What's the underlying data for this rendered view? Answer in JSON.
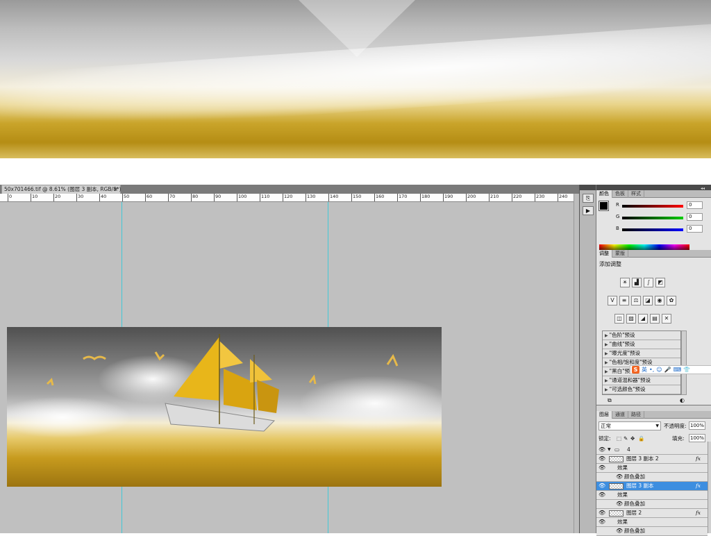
{
  "document": {
    "tab_title": "50x701466.tif @ 8.61% (图层 3 副本, RGB/8*)",
    "tab_close": "×",
    "ruler_ticks": [
      "0",
      "10",
      "20",
      "30",
      "40",
      "50",
      "60",
      "70",
      "80",
      "90",
      "100",
      "110",
      "120",
      "130",
      "140",
      "150",
      "160",
      "170",
      "180",
      "190",
      "200",
      "210",
      "220",
      "230",
      "240"
    ]
  },
  "panels": {
    "collapse_arrows": "◂◂",
    "color": {
      "tabs": [
        "颜色",
        "色板",
        "样式"
      ],
      "channels": [
        {
          "label": "R",
          "value": "0",
          "color": "#c00000"
        },
        {
          "label": "G",
          "value": "0",
          "color": "#00a000"
        },
        {
          "label": "B",
          "value": "0",
          "color": "#0000c0"
        }
      ]
    },
    "adjustments": {
      "tabs": [
        "调整",
        "蒙版"
      ],
      "title": "添加调整",
      "row1_icons": [
        "brightness-contrast-icon",
        "levels-icon",
        "curves-icon",
        "exposure-icon"
      ],
      "row2_icons": [
        "vibrance-icon",
        "hue-saturation-icon",
        "color-balance-icon",
        "black-white-icon",
        "photo-filter-icon",
        "channel-mixer-icon"
      ],
      "row3_icons": [
        "invert-icon",
        "posterize-icon",
        "threshold-icon",
        "gradient-map-icon",
        "selective-color-icon"
      ],
      "presets": [
        "\"色阶\"预设",
        "\"曲线\"预设",
        "\"曝光度\"预设",
        "\"色相/饱和度\"预设",
        "\"黑白\"预设",
        "\"通道混和器\"预设",
        "\"可选颜色\"预设"
      ],
      "ime": {
        "logo": "S",
        "lang": "英"
      }
    },
    "layers": {
      "tabs": [
        "图层",
        "通道",
        "路径"
      ],
      "blend_mode": "正常",
      "opacity_label": "不透明度:",
      "opacity_value": "100%",
      "lock_label": "锁定:",
      "fill_label": "填充:",
      "fill_value": "100%",
      "items": [
        {
          "name": "4",
          "type": "group",
          "fx": ""
        },
        {
          "name": "图层 3 副本 2",
          "type": "layer",
          "fx": "fx"
        },
        {
          "name": "效果",
          "type": "effects",
          "fx": ""
        },
        {
          "name": "颜色叠加",
          "type": "effect",
          "fx": ""
        },
        {
          "name": "图层 3 副本",
          "type": "layer",
          "fx": "fx",
          "selected": true
        },
        {
          "name": "效果",
          "type": "effects",
          "fx": ""
        },
        {
          "name": "颜色叠加",
          "type": "effect",
          "fx": ""
        },
        {
          "name": "图层 2",
          "type": "layer",
          "fx": "fx"
        },
        {
          "name": "效果",
          "type": "effects",
          "fx": ""
        },
        {
          "name": "颜色叠加",
          "type": "effect",
          "fx": ""
        }
      ]
    }
  }
}
